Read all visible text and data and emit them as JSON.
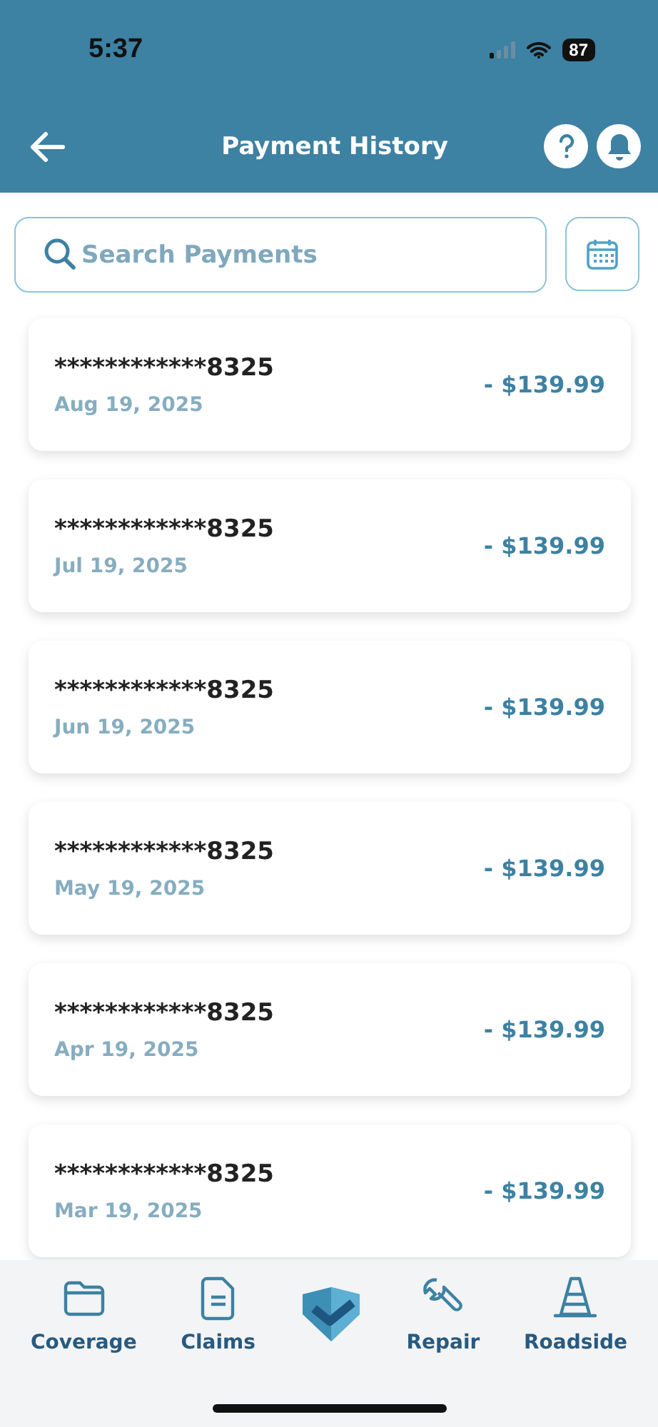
{
  "status_bar": {
    "time": "5:37",
    "battery": "87"
  },
  "header": {
    "title": "Payment History"
  },
  "search": {
    "placeholder": "Search Payments"
  },
  "payments": [
    {
      "card": "************8325",
      "date": "Aug 19, 2025",
      "amount": "- $139.99"
    },
    {
      "card": "************8325",
      "date": "Jul 19, 2025",
      "amount": "- $139.99"
    },
    {
      "card": "************8325",
      "date": "Jun 19, 2025",
      "amount": "- $139.99"
    },
    {
      "card": "************8325",
      "date": "May 19, 2025",
      "amount": "- $139.99"
    },
    {
      "card": "************8325",
      "date": "Apr 19, 2025",
      "amount": "- $139.99"
    },
    {
      "card": "************8325",
      "date": "Mar 19, 2025",
      "amount": "- $139.99"
    }
  ],
  "tab_bar": [
    {
      "label": "Coverage",
      "kind": "folder"
    },
    {
      "label": "Claims",
      "kind": "document"
    },
    {
      "kind": "shield"
    },
    {
      "label": "Repair",
      "kind": "wrench"
    },
    {
      "label": "Roadside",
      "kind": "cone"
    }
  ]
}
